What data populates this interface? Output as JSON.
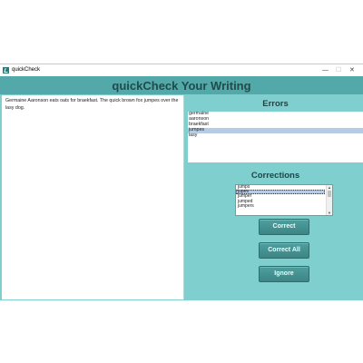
{
  "window": {
    "title": "quickCheck",
    "min": "—",
    "max": "☐",
    "close": "✕"
  },
  "app_title": "quickCheck Your Writing",
  "editor": {
    "text": "Germaine Aaronson eats oats for braekfast. The quick brown fox jumpes over the lasy dog."
  },
  "errors": {
    "title": "Errors",
    "items": [
      "germaine",
      "aaronson",
      "braekfast",
      "jumpes",
      "lasy"
    ],
    "selected_index": 3
  },
  "corrections": {
    "title": "Corrections",
    "items": [
      "jumps",
      "jupes",
      "jumper",
      "jumped",
      "jumpers"
    ],
    "selected_index": 1
  },
  "buttons": {
    "correct": "Correct",
    "correct_all": "Correct All",
    "ignore": "Ignore"
  }
}
